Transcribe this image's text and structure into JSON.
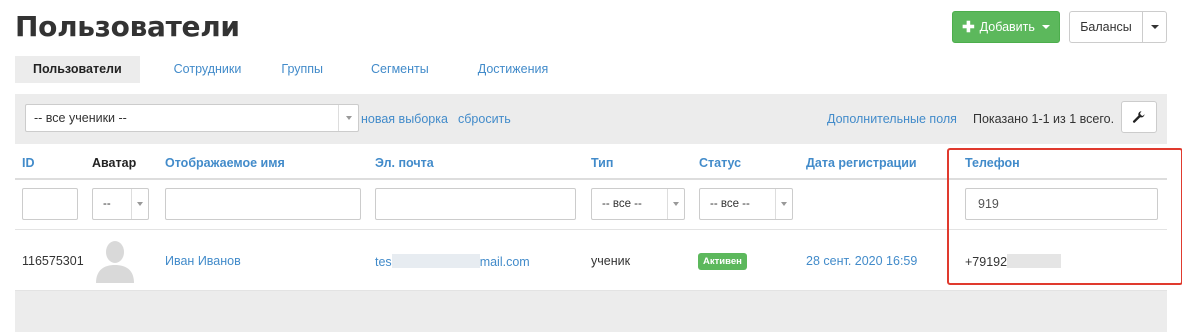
{
  "page": {
    "title": "Пользователи"
  },
  "header": {
    "add_label": "Добавить",
    "balance_label": "Балансы"
  },
  "tabs": [
    {
      "label": "Пользователи",
      "active": true
    },
    {
      "label": "Сотрудники",
      "active": false
    },
    {
      "label": "Группы",
      "active": false
    },
    {
      "label": "Сегменты",
      "active": false
    },
    {
      "label": "Достижения",
      "active": false
    }
  ],
  "filterbar": {
    "selection_value": "-- все ученики --",
    "new_selection": "новая выборка",
    "reset": "сбросить",
    "extra_fields": "Дополнительные поля",
    "shown": "Показано 1-1 из 1 всего."
  },
  "table": {
    "columns": [
      "ID",
      "Аватар",
      "Отображаемое имя",
      "Эл. почта",
      "Тип",
      "Статус",
      "Дата регистрации",
      "Телефон"
    ],
    "filters": {
      "avatar_select": "--",
      "type_select": "-- все --",
      "status_select": "-- все --",
      "phone_value": "919"
    },
    "rows": [
      {
        "id": "116575301",
        "name": "Иван Иванов",
        "email_start": "tes",
        "email_end": "mail.com",
        "type": "ученик",
        "status": "Активен",
        "registered": "28 сент. 2020 16:59",
        "phone_start": "+79192"
      }
    ]
  },
  "colors": {
    "accent": "#428bca",
    "success": "#5cb85c",
    "highlight": "#e03a2e",
    "panel": "#ececec"
  }
}
